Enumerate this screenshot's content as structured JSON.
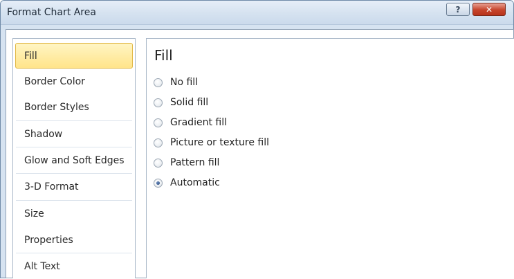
{
  "window": {
    "title": "Format Chart Area",
    "help_glyph": "?",
    "close_glyph": "✕"
  },
  "sidebar": {
    "items": [
      {
        "label": "Fill",
        "selected": true
      },
      {
        "label": "Border Color",
        "selected": false
      },
      {
        "label": "Border Styles",
        "selected": false
      },
      {
        "label": "Shadow",
        "selected": false
      },
      {
        "label": "Glow and Soft Edges",
        "selected": false
      },
      {
        "label": "3-D Format",
        "selected": false
      },
      {
        "label": "Size",
        "selected": false
      },
      {
        "label": "Properties",
        "selected": false
      },
      {
        "label": "Alt Text",
        "selected": false
      }
    ]
  },
  "content": {
    "heading": "Fill",
    "options": [
      {
        "label": "No fill",
        "checked": false
      },
      {
        "label": "Solid fill",
        "checked": false
      },
      {
        "label": "Gradient fill",
        "checked": false
      },
      {
        "label": "Picture or texture fill",
        "checked": false
      },
      {
        "label": "Pattern fill",
        "checked": false
      },
      {
        "label": "Automatic",
        "checked": true
      }
    ]
  },
  "colors": {
    "selected_highlight": "#ffe48a",
    "close_button": "#c6442b",
    "titlebar": "#d5e2f0"
  }
}
